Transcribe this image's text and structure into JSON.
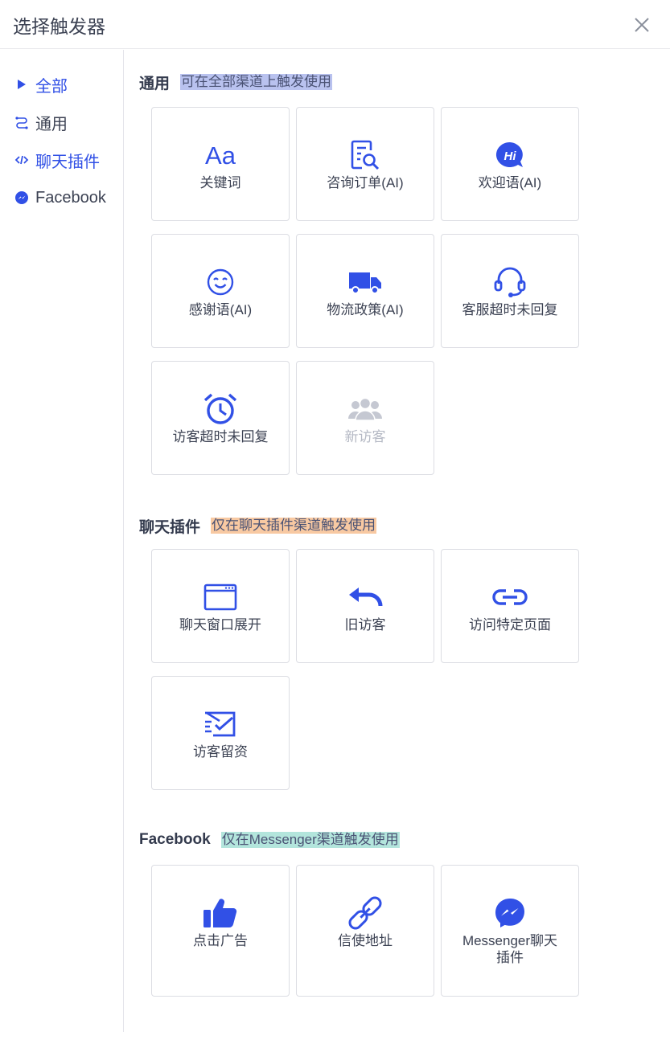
{
  "dialog": {
    "title": "选择触发器"
  },
  "sidebar": {
    "items": [
      {
        "label": "全部",
        "icon": "triangle-right-icon",
        "active": true
      },
      {
        "label": "通用",
        "icon": "route-icon",
        "active": false
      },
      {
        "label": "聊天插件",
        "icon": "code-arrows-icon",
        "active": true
      },
      {
        "label": "Facebook",
        "icon": "messenger-icon",
        "active": false
      }
    ]
  },
  "sections": [
    {
      "name": "通用",
      "desc": "可在全部渠道上触发使用",
      "desc_color": "#b9c2ef",
      "cards": [
        {
          "label": "关键词",
          "icon": "text-aa-icon"
        },
        {
          "label": "咨询订单(AI)",
          "icon": "order-search-icon"
        },
        {
          "label": "欢迎语(AI)",
          "icon": "hi-bubble-icon"
        },
        {
          "label": "感谢语(AI)",
          "icon": "smile-icon"
        },
        {
          "label": "物流政策(AI)",
          "icon": "truck-icon"
        },
        {
          "label": "客服超时未回复",
          "icon": "headset-icon"
        },
        {
          "label": "访客超时未回复",
          "icon": "alarm-clock-icon"
        },
        {
          "label": "新访客",
          "icon": "users-icon",
          "disabled": true
        }
      ]
    },
    {
      "name": "聊天插件",
      "desc": "仅在聊天插件渠道触发使用",
      "desc_color": "#f8c9a2",
      "cards": [
        {
          "label": "聊天窗口展开",
          "icon": "browser-window-icon"
        },
        {
          "label": "旧访客",
          "icon": "undo-arrow-icon"
        },
        {
          "label": "访问特定页面",
          "icon": "link-icon"
        },
        {
          "label": "访客留资",
          "icon": "envelope-check-icon"
        }
      ]
    },
    {
      "name": "Facebook",
      "desc": "仅在Messenger渠道触发使用",
      "desc_color": "#b3e5dc",
      "cards": [
        {
          "label": "点击广告",
          "icon": "thumbs-up-icon"
        },
        {
          "label": "信使地址",
          "icon": "chain-link-icon"
        },
        {
          "label": "Messenger聊天插件",
          "icon": "messenger-icon"
        }
      ]
    }
  ],
  "colors": {
    "accent": "#3150e6",
    "disabled": "#c5c8d2",
    "text": "#3c4253"
  }
}
